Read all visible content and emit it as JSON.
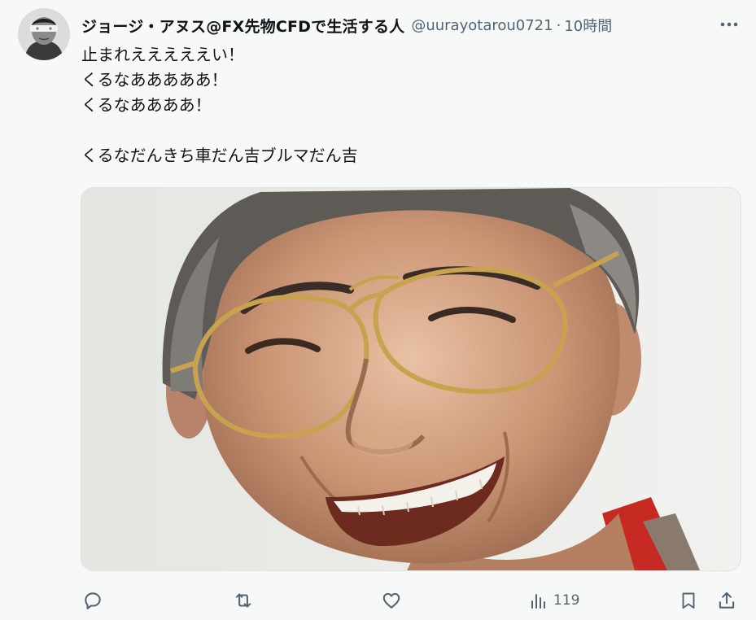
{
  "author": {
    "display_name": "ジョージ・アヌス@FX先物CFDで生活する人",
    "handle": "@uurayotarou0721",
    "separator": "·",
    "time": "10時間"
  },
  "tweet": {
    "lines": [
      "止まれえええええい！",
      "くるなあああああ！",
      "くるなああああ！",
      "",
      "くるなだんきち車だん吉ブルマだん吉"
    ]
  },
  "media": {
    "description_icon": "photo-of-smiling-man-with-glasses"
  },
  "actions": {
    "reply_icon": "reply-icon",
    "retweet_icon": "retweet-icon",
    "like_icon": "heart-icon",
    "views_icon": "views-icon",
    "views_count": "119",
    "bookmark_icon": "bookmark-icon",
    "share_icon": "share-icon"
  },
  "colors": {
    "text_primary": "#0f1419",
    "text_secondary": "#536471",
    "background": "#f7f9f9"
  }
}
